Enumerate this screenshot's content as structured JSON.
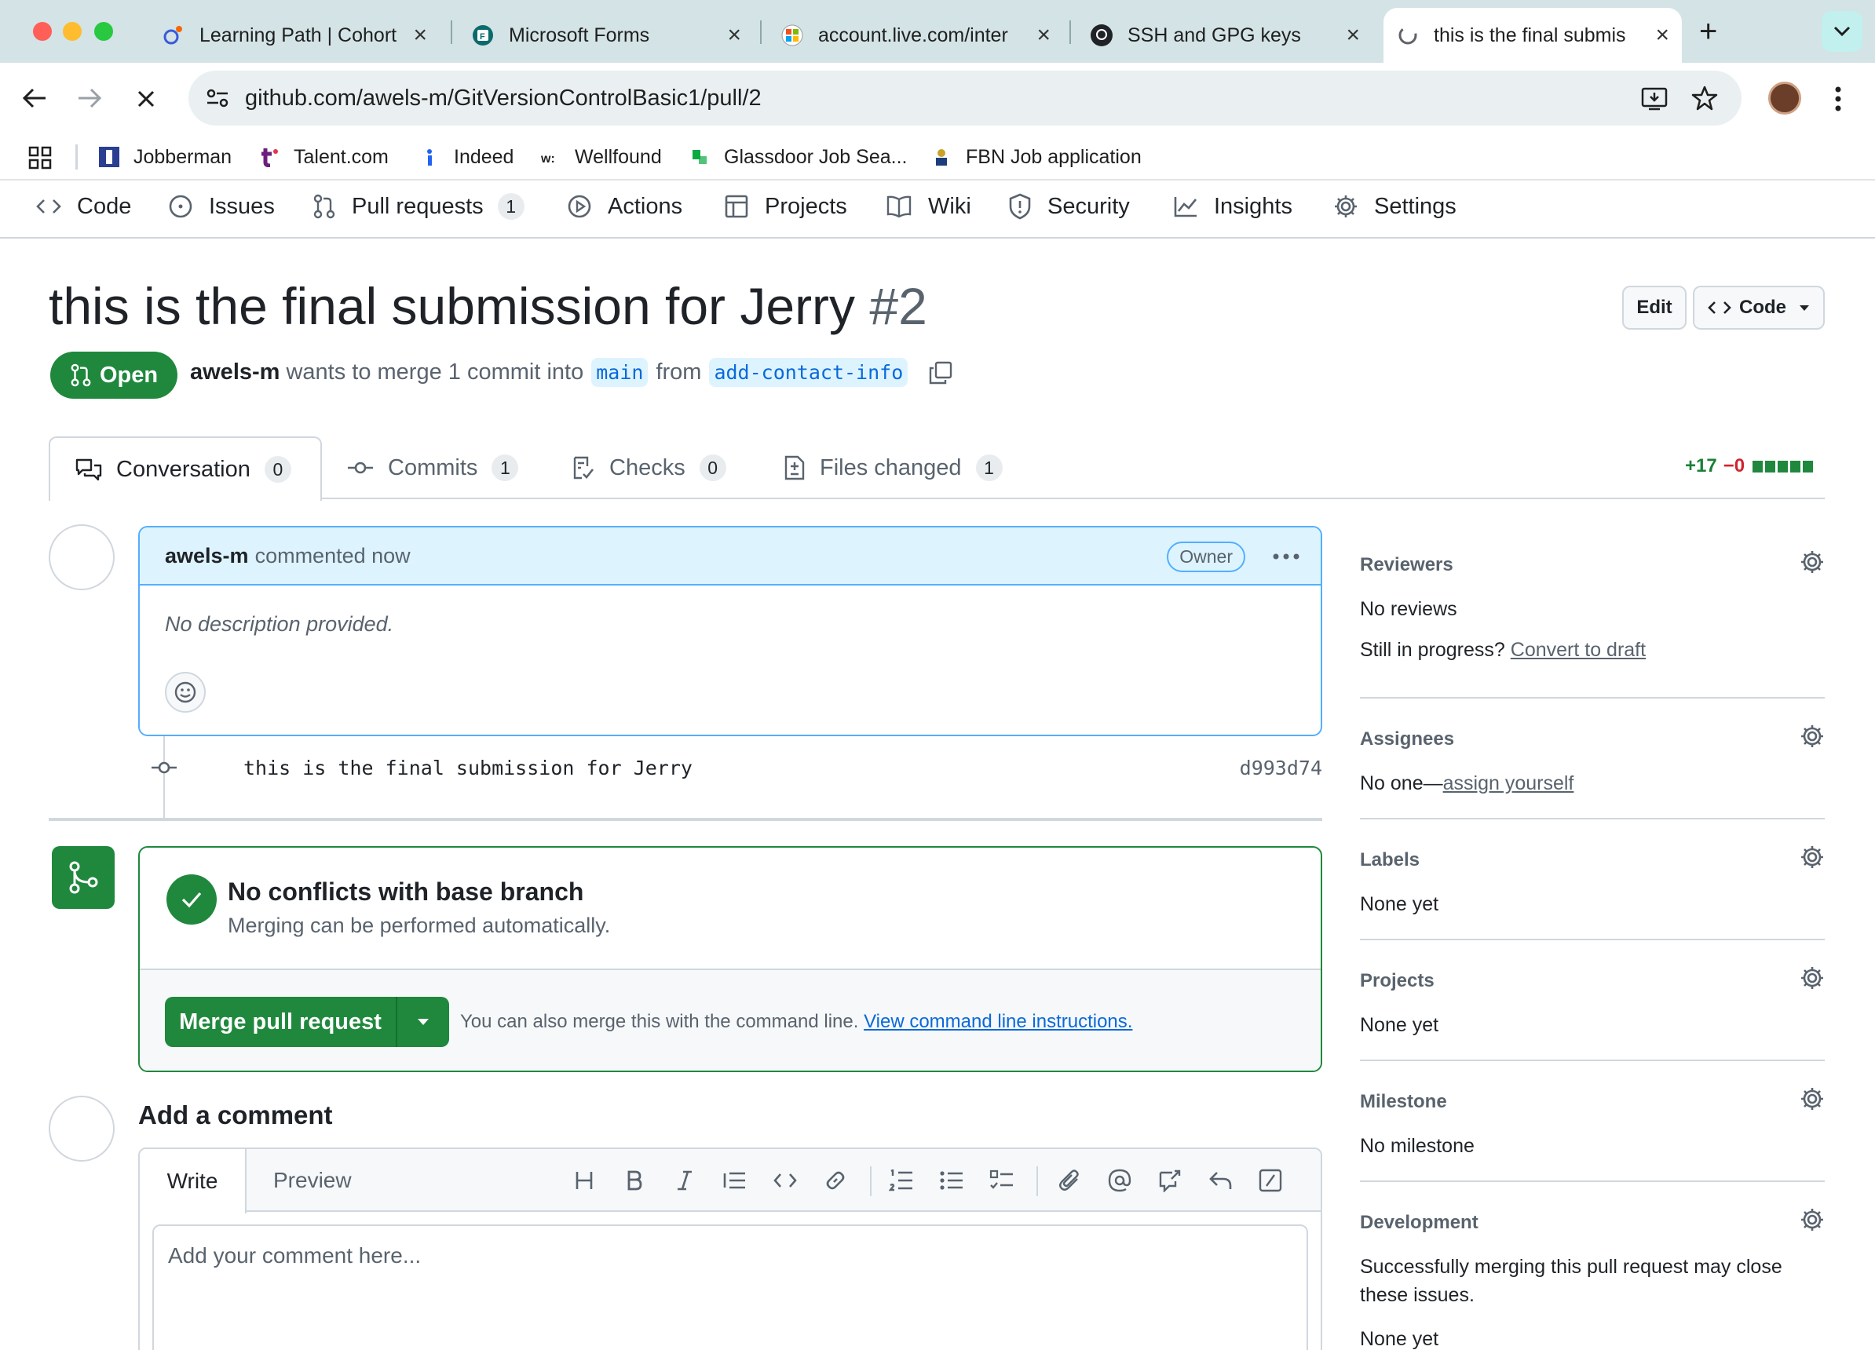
{
  "browser": {
    "tabs": [
      {
        "title": "Learning Path | Cohort",
        "icon": "cohort-icon"
      },
      {
        "title": "Microsoft Forms",
        "icon": "microsoft-forms-icon"
      },
      {
        "title": "account.live.com/inter",
        "icon": "microsoft-account-icon"
      },
      {
        "title": "SSH and GPG keys",
        "icon": "github-icon"
      },
      {
        "title": "this is the final submis",
        "icon": "loading-icon"
      }
    ],
    "url": "github.com/awels-m/GitVersionControlBasic1/pull/2",
    "bookmarks": [
      "Jobberman",
      "Talent.com",
      "Indeed",
      "Wellfound",
      "Glassdoor Job Sea...",
      "FBN Job application"
    ]
  },
  "repo_nav": {
    "items": [
      {
        "label": "Code"
      },
      {
        "label": "Issues"
      },
      {
        "label": "Pull requests",
        "count": "1"
      },
      {
        "label": "Actions"
      },
      {
        "label": "Projects"
      },
      {
        "label": "Wiki"
      },
      {
        "label": "Security"
      },
      {
        "label": "Insights"
      },
      {
        "label": "Settings"
      }
    ]
  },
  "pr": {
    "title": "this is the final submission for Jerry",
    "number": "#2",
    "edit_label": "Edit",
    "code_label": "Code",
    "state": "Open",
    "author": "awels-m",
    "merge_text": "wants to merge 1 commit into",
    "base_branch": "main",
    "from_text": "from",
    "head_branch": "add-contact-info"
  },
  "pr_tabs": [
    {
      "label": "Conversation",
      "count": "0"
    },
    {
      "label": "Commits",
      "count": "1"
    },
    {
      "label": "Checks",
      "count": "0"
    },
    {
      "label": "Files changed",
      "count": "1"
    }
  ],
  "diffstat": {
    "added": "+17",
    "removed": "−0"
  },
  "comment": {
    "author": "awels-m",
    "action": "commented now",
    "badge": "Owner",
    "body": "No description provided."
  },
  "commit": {
    "message": "this is the final submission for Jerry",
    "sha": "d993d74"
  },
  "merge": {
    "title": "No conflicts with base branch",
    "subtitle": "Merging can be performed automatically.",
    "button_label": "Merge pull request",
    "hint": "You can also merge this with the command line.",
    "hint_link": "View command line instructions."
  },
  "add_comment": {
    "title": "Add a comment",
    "write_tab": "Write",
    "preview_tab": "Preview",
    "placeholder": "Add your comment here..."
  },
  "sidebar": {
    "reviewers": {
      "title": "Reviewers",
      "value": "No reviews",
      "progress_text": "Still in progress?",
      "convert_link": "Convert to draft"
    },
    "assignees": {
      "title": "Assignees",
      "value": "No one—",
      "assign_link": "assign yourself"
    },
    "labels": {
      "title": "Labels",
      "value": "None yet"
    },
    "projects": {
      "title": "Projects",
      "value": "None yet"
    },
    "milestone": {
      "title": "Milestone",
      "value": "No milestone"
    },
    "development": {
      "title": "Development",
      "value": "Successfully merging this pull request may close these issues.",
      "value2": "None yet"
    }
  },
  "colors": {
    "accent_green": "#1f883d",
    "link_blue": "#0969da",
    "danger_red": "#d1242f"
  }
}
